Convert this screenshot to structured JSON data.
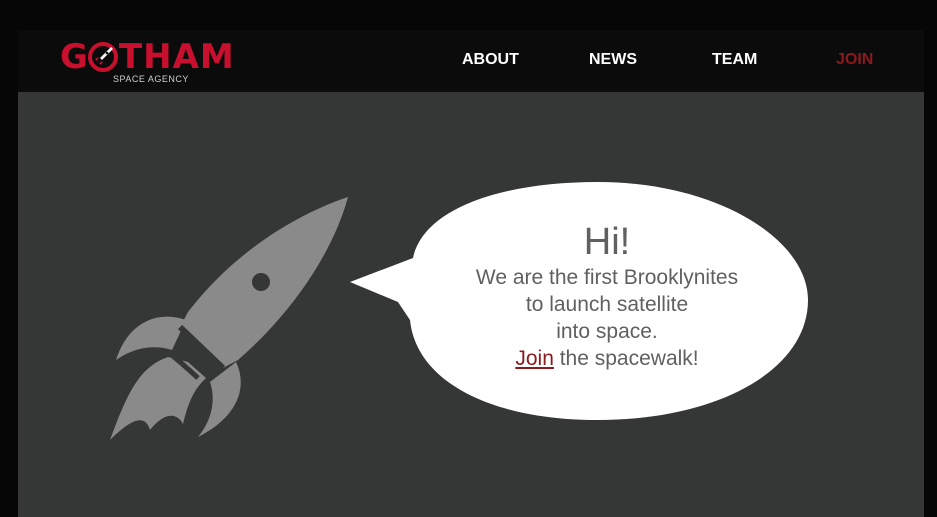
{
  "header": {
    "logo": {
      "word_left": "G",
      "word_right": "THAM",
      "tagline": "SPACE AGENCY",
      "brand_color": "#c8102e"
    },
    "nav": [
      {
        "label": "ABOUT"
      },
      {
        "label": "NEWS"
      },
      {
        "label": "TEAM"
      },
      {
        "label": "JOIN",
        "color": "#8b1a1f"
      }
    ]
  },
  "hero": {
    "icon": "rocket-icon",
    "bubble": {
      "greeting": "Hi!",
      "line1": "We are the first Brooklynites",
      "line2": "to launch satellite",
      "line3": "into space.",
      "join_link": "Join",
      "line4_rest": " the spacewalk!"
    }
  },
  "colors": {
    "background": "#353636",
    "header": "#0b0b0b",
    "rocket": "#8a8a8a",
    "bubble": "#ffffff",
    "link": "#8b1a1f"
  }
}
